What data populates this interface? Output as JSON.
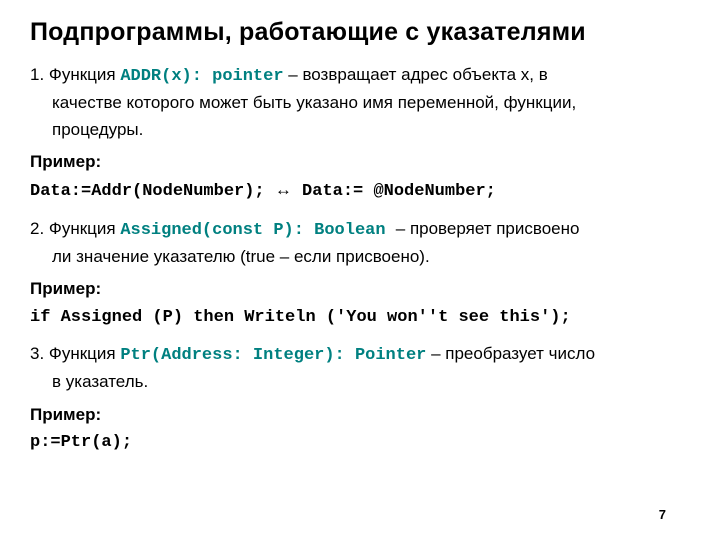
{
  "title": "Подпрограммы, работающие с указателями",
  "items": {
    "i1": {
      "lead": "1. Функция ",
      "code": "ADDR(x): pointer",
      "tail1": " – возвращает адрес объекта x, в",
      "tail2": "качестве которого может быть указано имя переменной, функции,",
      "tail3": "процедуры.",
      "example_label": "Пример:",
      "example_a": "Data:=Addr(NodeNumber); ",
      "arrow": "↔",
      "example_b": " Data:= @NodeNumber;"
    },
    "i2": {
      "lead": "2. Функция ",
      "code": "Assigned(const P): Boolean ",
      "tail1": " – проверяет присвоено",
      "tail2": "ли значение указателю (true – если присвоено).",
      "example_label": "Пример:",
      "example": "if Assigned (P) then Writeln ('You won''t see this');"
    },
    "i3": {
      "lead": "3. Функция ",
      "code": "Ptr(Address: Integer): Pointer",
      "tail1": " – преобразует число",
      "tail2": "в указатель.",
      "example_label": "Пример:",
      "example": "p:=Ptr(a);"
    }
  },
  "page_number": "7"
}
